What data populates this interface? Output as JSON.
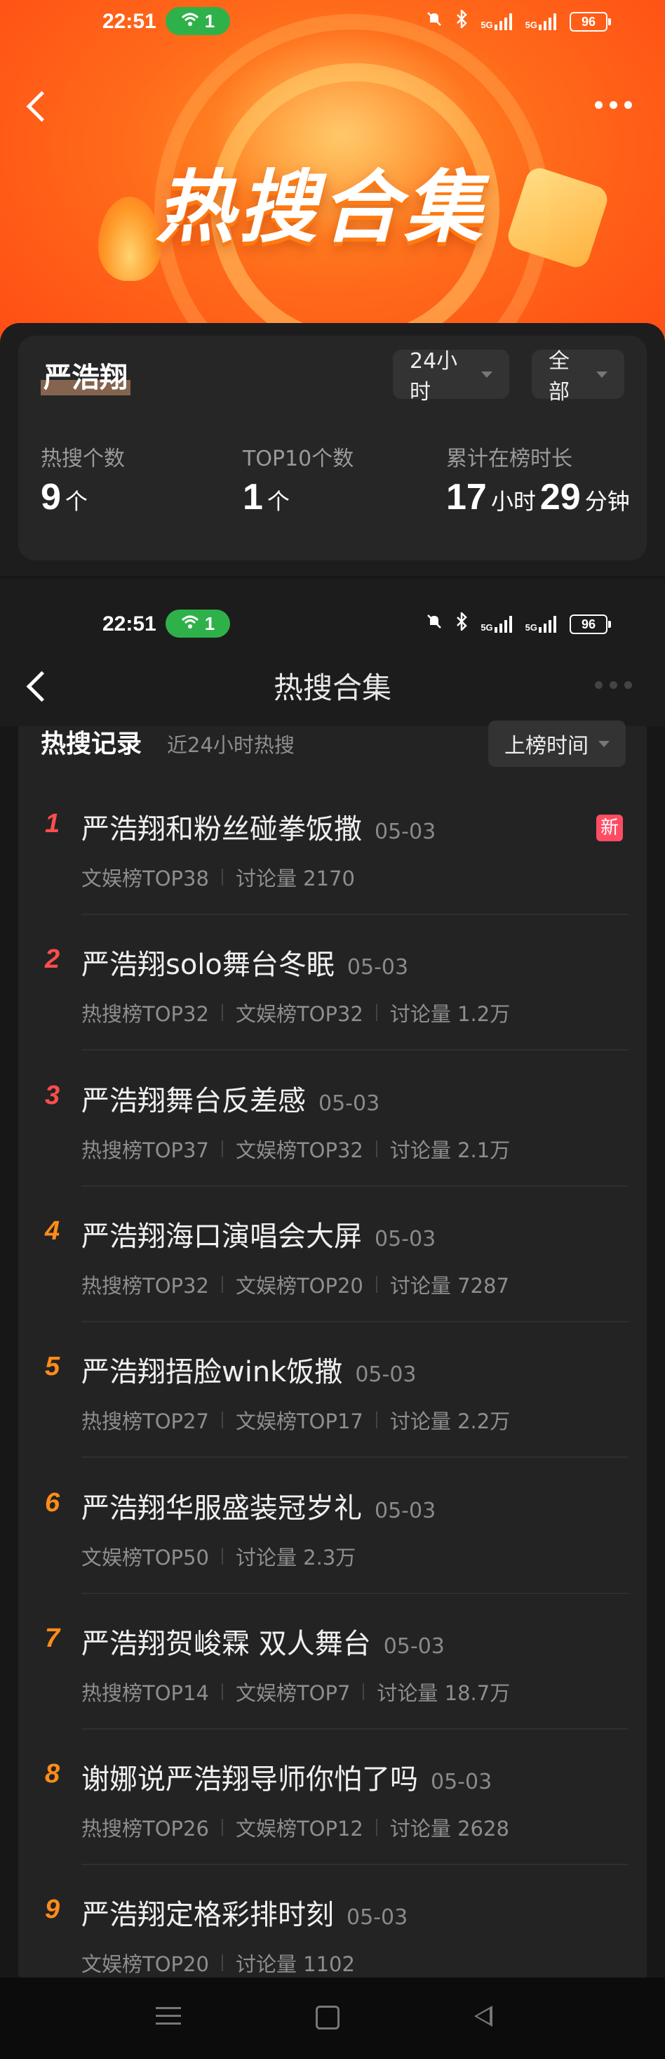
{
  "status_top": {
    "time": "22:51",
    "wifi_count": "1",
    "signal1": "5G",
    "signal2": "5G",
    "battery": "96"
  },
  "status_mid": {
    "time": "22:51",
    "wifi_count": "1",
    "signal1": "5G",
    "signal2": "5G",
    "battery": "96"
  },
  "banner": {
    "title": "热搜合集"
  },
  "summary": {
    "person": "严浩翔",
    "filter_time": "24小时",
    "filter_type": "全部",
    "stats": [
      {
        "label": "热搜个数",
        "value": "9",
        "unit": "个"
      },
      {
        "label": "TOP10个数",
        "value": "1",
        "unit": "个"
      },
      {
        "label": "累计在榜时长",
        "hours": "17",
        "hours_unit": "小时",
        "minutes": "29",
        "minutes_unit": "分钟"
      }
    ]
  },
  "page": {
    "title": "热搜合集"
  },
  "records": {
    "title": "热搜记录",
    "subtitle": "近24小时热搜",
    "sort_label": "上榜时间",
    "items": [
      {
        "rank": "1",
        "rank_color": "#ff4d4d",
        "title": "严浩翔和粉丝碰拳饭撒",
        "date": "05-03",
        "tags": [
          "文娱榜TOP38",
          "讨论量 2170"
        ],
        "badge": "新"
      },
      {
        "rank": "2",
        "rank_color": "#ff4d4d",
        "title": "严浩翔solo舞台冬眠",
        "date": "05-03",
        "tags": [
          "热搜榜TOP32",
          "文娱榜TOP32",
          "讨论量 1.2万"
        ]
      },
      {
        "rank": "3",
        "rank_color": "#ff4d4d",
        "title": "严浩翔舞台反差感",
        "date": "05-03",
        "tags": [
          "热搜榜TOP37",
          "文娱榜TOP32",
          "讨论量 2.1万"
        ]
      },
      {
        "rank": "4",
        "rank_color": "#ff8c1a",
        "title": "严浩翔海口演唱会大屏",
        "date": "05-03",
        "tags": [
          "热搜榜TOP32",
          "文娱榜TOP20",
          "讨论量 7287"
        ]
      },
      {
        "rank": "5",
        "rank_color": "#ff8c1a",
        "title": "严浩翔捂脸wink饭撒",
        "date": "05-03",
        "tags": [
          "热搜榜TOP27",
          "文娱榜TOP17",
          "讨论量 2.2万"
        ]
      },
      {
        "rank": "6",
        "rank_color": "#ff8c1a",
        "title": "严浩翔华服盛装冠岁礼",
        "date": "05-03",
        "tags": [
          "文娱榜TOP50",
          "讨论量 2.3万"
        ]
      },
      {
        "rank": "7",
        "rank_color": "#ff8c1a",
        "title": "严浩翔贺峻霖 双人舞台",
        "date": "05-03",
        "tags": [
          "热搜榜TOP14",
          "文娱榜TOP7",
          "讨论量 18.7万"
        ]
      },
      {
        "rank": "8",
        "rank_color": "#ff8c1a",
        "title": "谢娜说严浩翔导师你怕了吗",
        "date": "05-03",
        "tags": [
          "热搜榜TOP26",
          "文娱榜TOP12",
          "讨论量 2628"
        ]
      },
      {
        "rank": "9",
        "rank_color": "#ff8c1a",
        "title": "严浩翔定格彩排时刻",
        "date": "05-03",
        "tags": [
          "文娱榜TOP20",
          "讨论量 1102"
        ]
      }
    ]
  }
}
